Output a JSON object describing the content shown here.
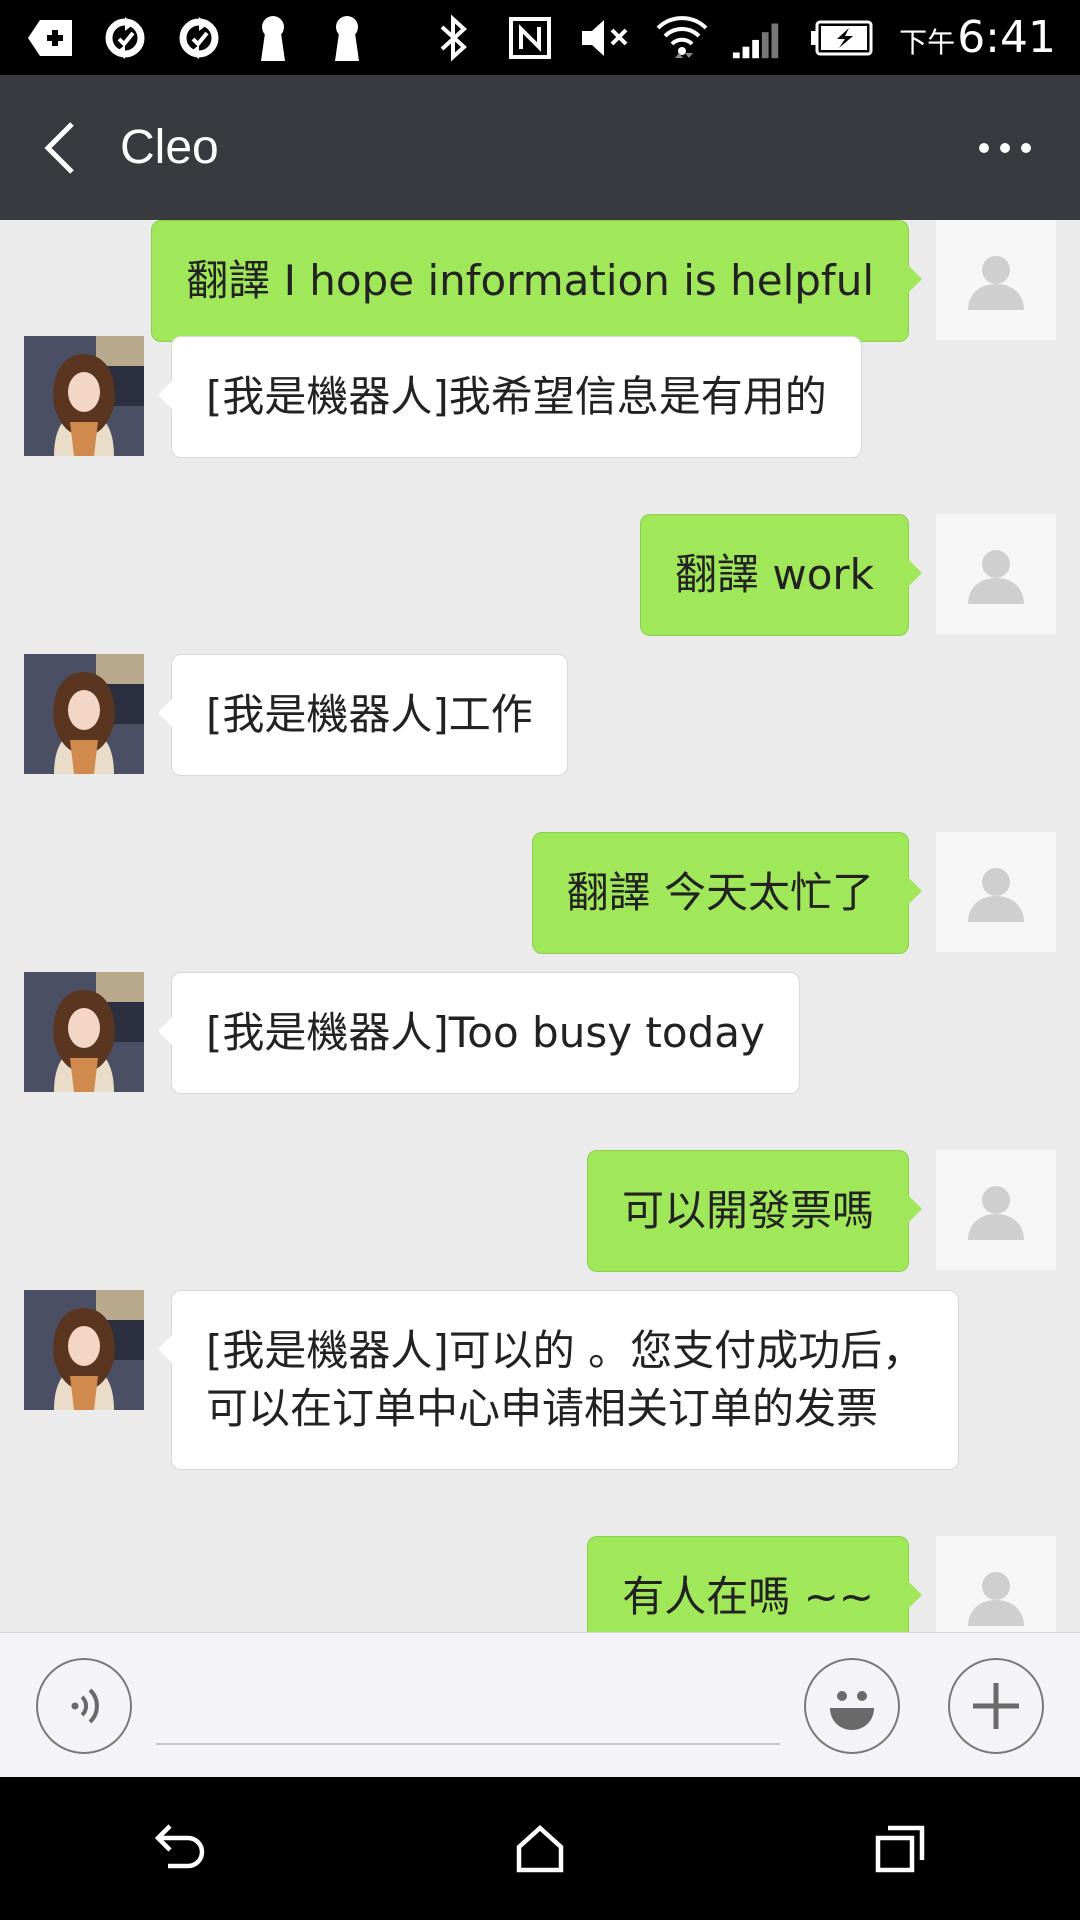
{
  "status_bar": {
    "icons": [
      "add-box-icon",
      "sync-icon",
      "sync-icon",
      "keyhole-icon",
      "keyhole-icon",
      "bluetooth-icon",
      "nfc-icon",
      "mute-icon",
      "wifi-icon",
      "signal-icon",
      "battery-charging-icon"
    ],
    "meridiem": "下午",
    "time": "6:41"
  },
  "header": {
    "title": "Cleo",
    "back_icon": "chevron-left-icon",
    "more_icon": "more-icon"
  },
  "messages": [
    {
      "sender": "self",
      "lines": [
        "翻譯 I hope information is helpful"
      ]
    },
    {
      "sender": "contact",
      "lines": [
        "[我是機器人]我希望信息是有用的"
      ]
    },
    {
      "sender": "self",
      "lines": [
        "翻譯 work"
      ]
    },
    {
      "sender": "contact",
      "lines": [
        "[我是機器人]工作"
      ]
    },
    {
      "sender": "self",
      "lines": [
        "翻譯 今天太忙了"
      ]
    },
    {
      "sender": "contact",
      "lines": [
        "[我是機器人]Too busy today"
      ]
    },
    {
      "sender": "self",
      "lines": [
        "可以開發票嗎"
      ]
    },
    {
      "sender": "contact",
      "lines": [
        "[我是機器人]可以的 。您支付成功后，",
        "可以在订单中心申请相关订单的发票"
      ]
    },
    {
      "sender": "self",
      "lines": [
        "有人在嗎 ~~"
      ]
    }
  ],
  "input_bar": {
    "value": "",
    "voice_icon": "voice-icon",
    "emoji_icon": "emoji-icon",
    "plus_icon": "plus-icon"
  },
  "nav_bar": {
    "icons": [
      "back-arrow-icon",
      "home-icon",
      "recent-apps-icon"
    ]
  },
  "colors": {
    "header_bg": "#393a3f",
    "chat_bg": "#ebebeb",
    "outgoing_bubble": "#a0e75a",
    "incoming_bubble": "#ffffff"
  }
}
